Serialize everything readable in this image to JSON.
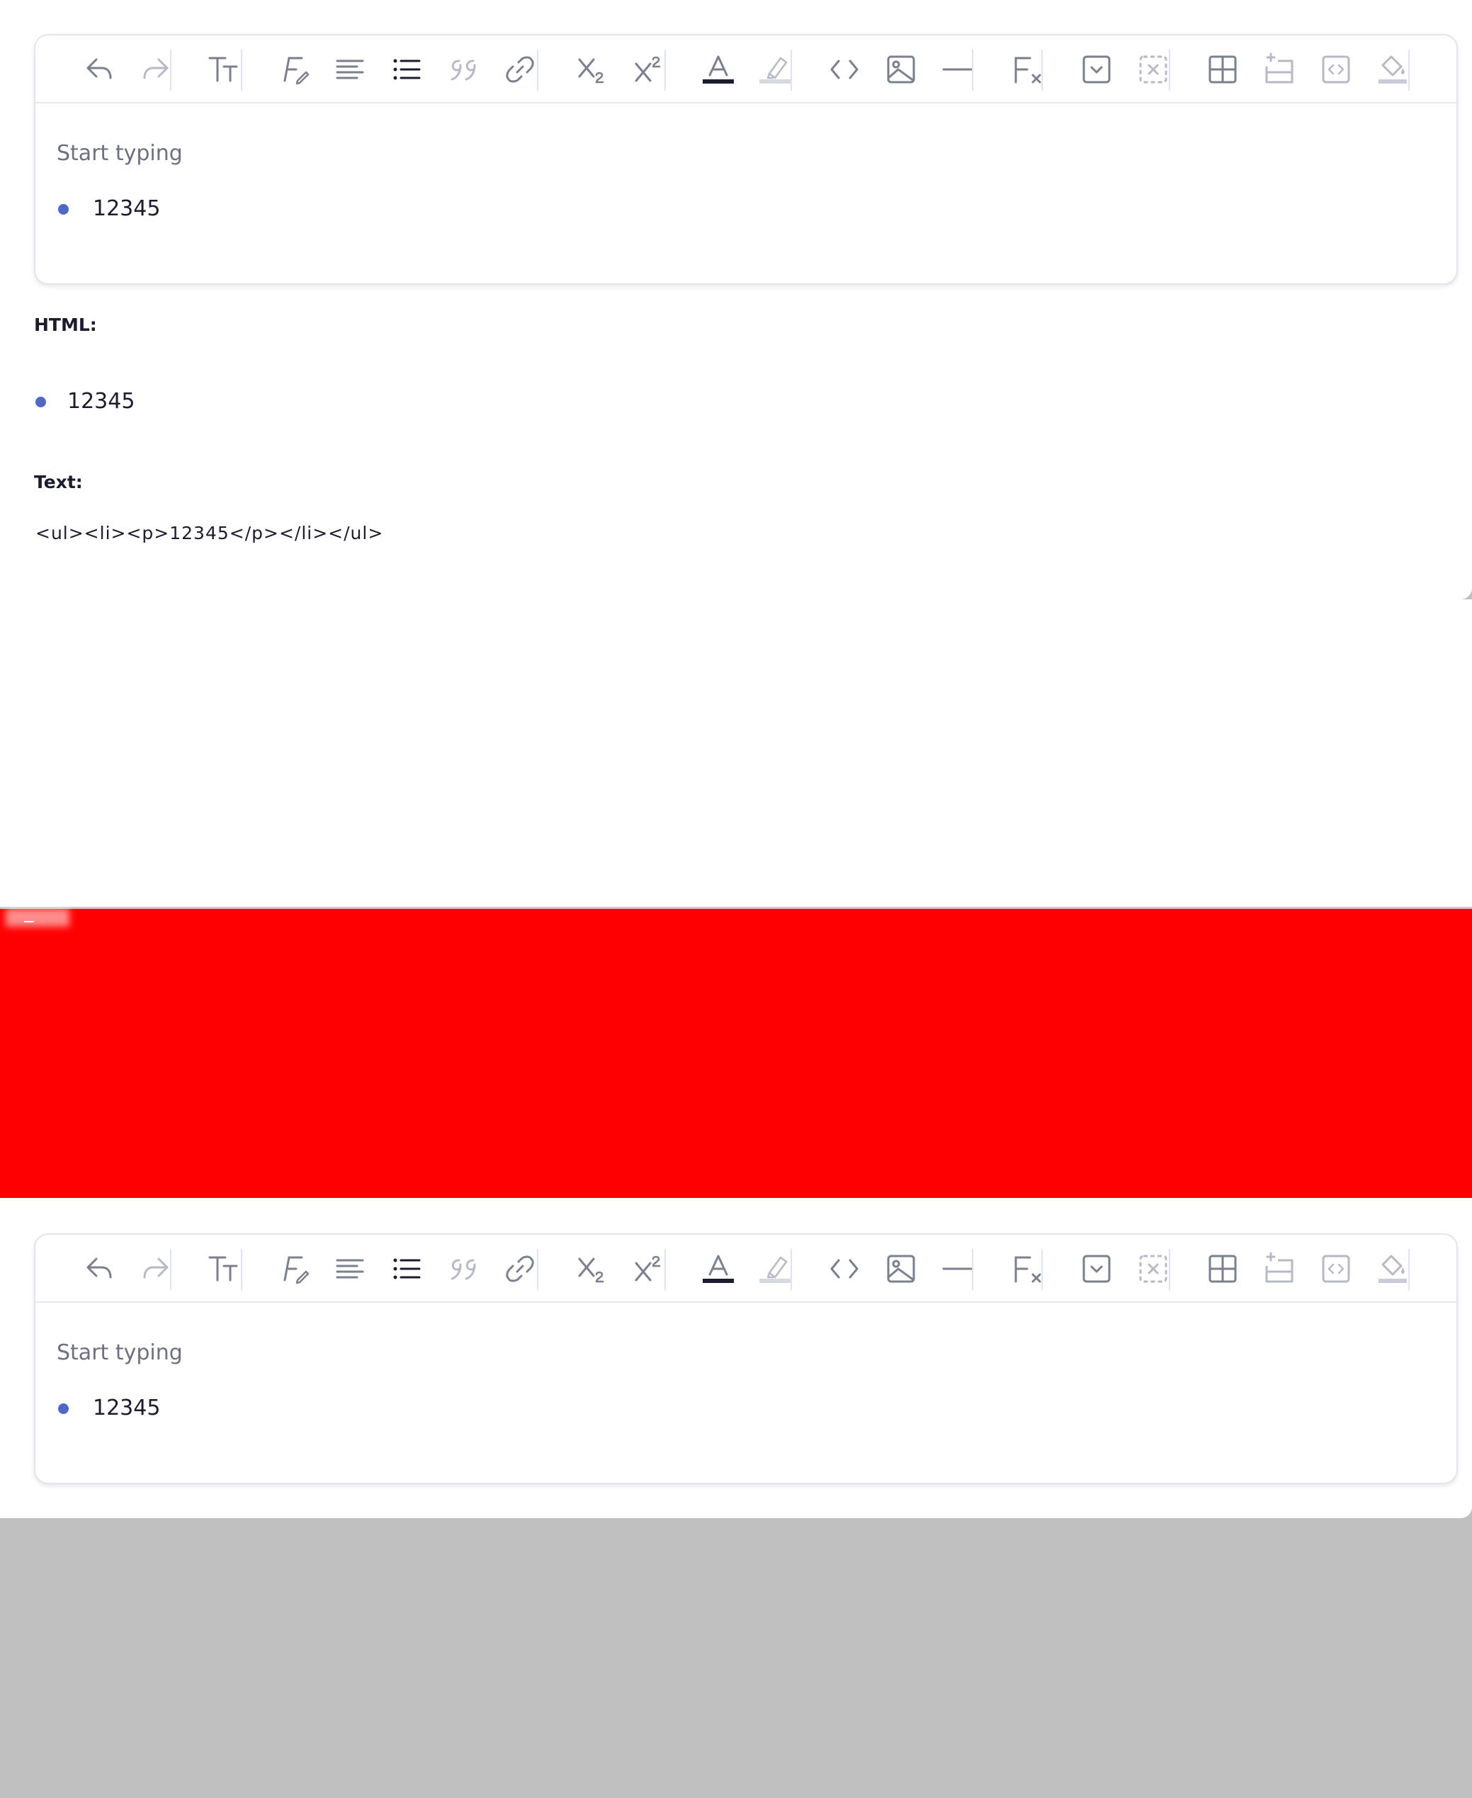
{
  "colors": {
    "accent_bullet": "#4f68c8",
    "red_band": "#ff0000",
    "background_gray": "#c0c0c0",
    "text_dark": "#1b1d2e",
    "placeholder_gray": "#6d7081"
  },
  "toolbar": {
    "items": [
      {
        "icon": "undo-icon"
      },
      {
        "icon": "redo-icon"
      },
      {
        "icon": "font-size-icon"
      },
      {
        "icon": "font-style-icon"
      },
      {
        "icon": "align-left-icon"
      },
      {
        "icon": "bullet-list-icon"
      },
      {
        "icon": "blockquote-icon"
      },
      {
        "icon": "link-icon"
      },
      {
        "icon": "subscript-icon"
      },
      {
        "icon": "superscript-icon"
      },
      {
        "icon": "text-color-icon"
      },
      {
        "icon": "highlight-icon"
      },
      {
        "icon": "code-icon"
      },
      {
        "icon": "image-icon"
      },
      {
        "icon": "horizontal-rule-icon"
      },
      {
        "icon": "clear-format-icon"
      },
      {
        "icon": "details-icon"
      },
      {
        "icon": "remove-details-icon"
      },
      {
        "icon": "table-icon"
      },
      {
        "icon": "add-row-icon"
      },
      {
        "icon": "embed-icon"
      },
      {
        "icon": "fill-color-icon"
      }
    ]
  },
  "editor_top": {
    "placeholder": "Start typing",
    "list_items": [
      "12345"
    ]
  },
  "output": {
    "html_label": "HTML:",
    "html_rendered_items": [
      "12345"
    ],
    "text_label": "Text:",
    "text_value": "<ul><li><p>12345</p></li></ul>"
  },
  "editor_bottom": {
    "placeholder": "Start typing",
    "list_items": [
      "12345"
    ]
  }
}
